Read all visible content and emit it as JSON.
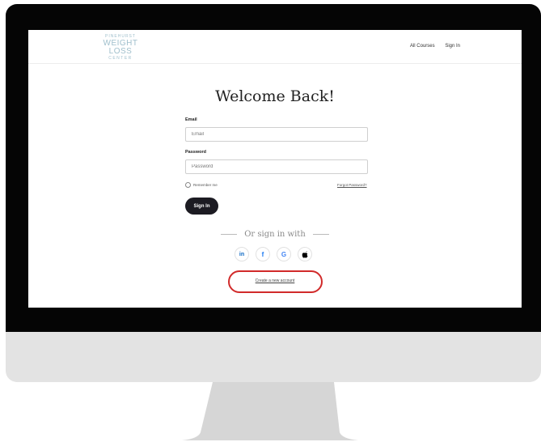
{
  "logo": {
    "line1": "PINEHURST",
    "line2": "WEIGHT LOSS",
    "line3": "CENTER"
  },
  "nav": {
    "courses": "All Courses",
    "signin": "Sign In"
  },
  "form": {
    "title": "Welcome Back!",
    "email_label": "Email",
    "email_placeholder": "Email",
    "password_label": "Password",
    "password_placeholder": "Password",
    "remember": "Remember me",
    "forgot": "Forgot Password?",
    "submit": "Sign In"
  },
  "social": {
    "heading": "Or sign in with",
    "buttons": [
      {
        "icon": "linkedin-icon",
        "glyph": "in",
        "color": "#0a66c2"
      },
      {
        "icon": "facebook-icon",
        "glyph": "f",
        "color": "#1877f2"
      },
      {
        "icon": "google-icon",
        "glyph": "G",
        "color": "#4285f4"
      },
      {
        "icon": "apple-icon",
        "glyph": "",
        "color": "#000000"
      }
    ]
  },
  "create_account": "Create a new account",
  "colors": {
    "button_bg": "#1c1b22",
    "highlight": "#d12a2a",
    "logo": "#9fbfcc"
  }
}
